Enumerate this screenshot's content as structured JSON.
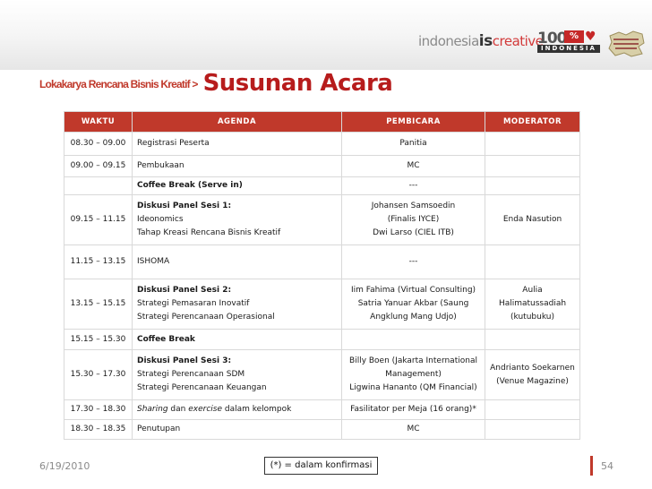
{
  "header": {
    "brand_part1": "indonesia",
    "brand_part2": "is",
    "brand_part3": "creative",
    "logo_number": "100",
    "logo_percent": "%",
    "logo_label": "INDONESIA",
    "breadcrumb": "Lokakarya Rencana Bisnis Kreatif >",
    "title": "Susunan Acara"
  },
  "table": {
    "headers": [
      "WAKTU",
      "AGENDA",
      "PEMBICARA",
      "MODERATOR"
    ],
    "rows": [
      {
        "time": "08.30 – 09.00",
        "agenda": [
          "Registrasi Peserta"
        ],
        "speaker": [
          "Panitia"
        ],
        "moderator": [
          ""
        ]
      },
      {
        "time": "09.00 – 09.15",
        "agenda": [
          "Pembukaan"
        ],
        "speaker": [
          "MC"
        ],
        "moderator": [
          ""
        ]
      },
      {
        "time": "",
        "agenda": [
          "Coffee Break (Serve in)"
        ],
        "speaker": [
          "---"
        ],
        "moderator": [
          ""
        ]
      },
      {
        "time": "09.15 – 11.15",
        "agenda": [
          "Diskusi Panel Sesi 1:",
          "Ideonomics",
          "Tahap Kreasi Rencana Bisnis Kreatif"
        ],
        "speaker": [
          "Johansen Samsoedin",
          "(Finalis IYCE)",
          "Dwi Larso (CIEL ITB)"
        ],
        "moderator": [
          "Enda Nasution"
        ]
      },
      {
        "time": "11.15 – 13.15",
        "agenda": [
          "ISHOMA"
        ],
        "speaker": [
          "---"
        ],
        "moderator": [
          ""
        ]
      },
      {
        "time": "13.15 – 15.15",
        "agenda": [
          "Diskusi Panel Sesi 2:",
          "Strategi Pemasaran Inovatif",
          "Strategi Perencanaan Operasional"
        ],
        "speaker": [
          "Iim Fahima (Virtual Consulting)",
          "Satria Yanuar Akbar (Saung",
          "Angklung Mang Udjo)"
        ],
        "moderator": [
          "Aulia",
          "Halimatussadiah",
          "(kutubuku)"
        ]
      },
      {
        "time": "15.15 – 15.30",
        "agenda": [
          "Coffee Break"
        ],
        "speaker": [
          ""
        ],
        "moderator": [
          ""
        ]
      },
      {
        "time": "15.30 – 17.30",
        "agenda": [
          "Diskusi Panel Sesi 3:",
          "Strategi Perencanaan SDM",
          "Strategi Perencanaan Keuangan"
        ],
        "speaker": [
          "Billy Boen (Jakarta International",
          "Management)",
          "Ligwina Hananto (QM Financial)"
        ],
        "moderator": [
          "Andrianto Soekarnen",
          "(Venue Magazine)"
        ]
      },
      {
        "time": "17.30 – 18.30",
        "agenda_parts": [
          "Sharing",
          " dan ",
          "exercise",
          " dalam kelompok"
        ],
        "speaker": [
          "Fasilitator per Meja (16 orang)*"
        ],
        "moderator": [
          ""
        ]
      },
      {
        "time": "18.30 – 18.35",
        "agenda": [
          "Penutupan"
        ],
        "speaker": [
          "MC"
        ],
        "moderator": [
          ""
        ]
      }
    ]
  },
  "footer": {
    "date": "6/19/2010",
    "note": "(*) = dalam konfirmasi",
    "page_number": "54"
  },
  "colors": {
    "accent": "#c0392b",
    "title": "#b71c1c",
    "footer_text": "#8a8a8a"
  }
}
